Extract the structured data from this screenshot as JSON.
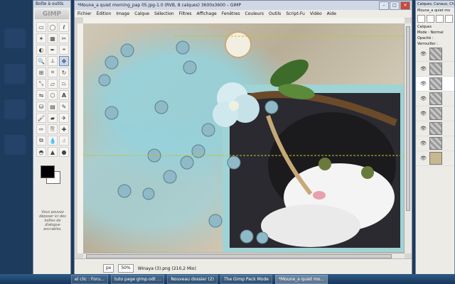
{
  "toolbox": {
    "title": "Boîte à outils",
    "logo": "GIMP",
    "hint": "Vous pouvez déposer ici des boîtes de dialogue ancrables."
  },
  "image_window": {
    "title": "*Moune_a quiet morning_pap 05.jpg-1.0 (RVB, 8 calques) 3600x3600 – GIMP",
    "menu": [
      "Fichier",
      "Édition",
      "Image",
      "Calque",
      "Sélection",
      "Filtres",
      "Affichage",
      "Fenêtres",
      "Couleurs",
      "Outils",
      "Script-Fu",
      "Vidéo",
      "Aide"
    ],
    "status": {
      "unit": "px",
      "zoom": "50%",
      "info": "Winaya (3).png (210,2 Mio)"
    }
  },
  "layers_panel": {
    "title": "Calques, Canaux, Che...",
    "image_name": "Moune_a quiet mo",
    "section": "Calques",
    "mode_label": "Mode :",
    "mode_value": "Normal",
    "opacity_label": "Opacité :",
    "lock_label": "Verrouiller :"
  },
  "taskbar": {
    "items": [
      "el clic : Foru...",
      "tuto page gimp.odt ...",
      "Nouveau dossier (2)",
      "The Gimp Pack Mode",
      "*Moune_a quiet mo..."
    ]
  }
}
